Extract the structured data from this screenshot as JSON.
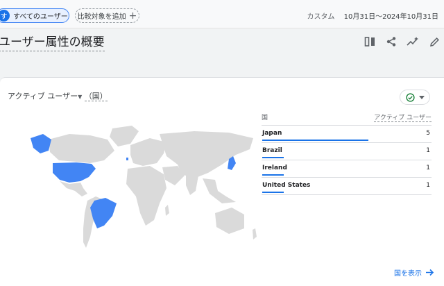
{
  "topbar": {
    "segment_avatar": "す",
    "segment_label": "すべてのユーザー",
    "add_compare_label": "比較対象を追加",
    "date_kind": "カスタム",
    "date_range": "10月31日～2024年10月31日"
  },
  "page": {
    "title": "ユーザー属性の概要"
  },
  "card": {
    "title_metric": "アクティブ ユーザー",
    "title_dimension": "（国）",
    "table": {
      "col_dimension": "国",
      "col_metric": "アクティブ ユーザー",
      "rows": [
        {
          "country": "Japan",
          "value": "5",
          "share": 1.0
        },
        {
          "country": "Brazil",
          "value": "1",
          "share": 0.2
        },
        {
          "country": "Ireland",
          "value": "1",
          "share": 0.2
        },
        {
          "country": "United States",
          "value": "1",
          "share": 0.2
        }
      ]
    },
    "view_link": "国を表示"
  },
  "colors": {
    "accent": "#1a73e8",
    "map_highlight": "#4285f4",
    "map_land": "#dadada",
    "status_ok": "#188038"
  },
  "icons": [
    "compare-icon",
    "share-icon",
    "insights-icon",
    "edit-icon",
    "check-circle-icon",
    "chevron-down-icon",
    "arrow-right-icon"
  ]
}
